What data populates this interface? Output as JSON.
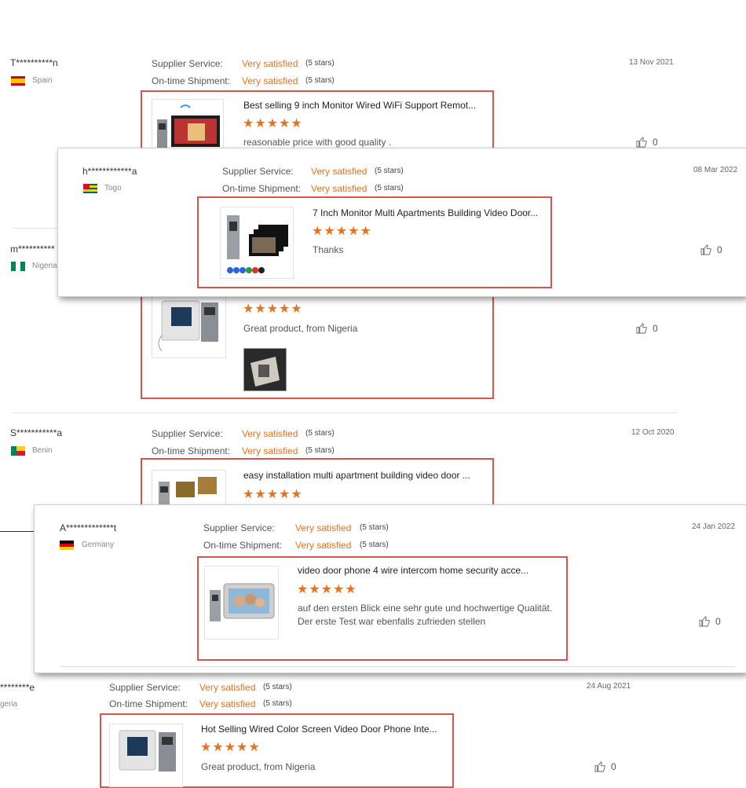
{
  "labels": {
    "supplier": "Supplier Service:",
    "shipment": "On-time Shipment:"
  },
  "colors": {
    "accent": "#e8721e",
    "highlight_box": "#d9534f"
  },
  "icons": {
    "like": "thumbs-up-icon",
    "star": "star-icon"
  },
  "reviews": [
    {
      "user": "T**********n",
      "country": "Spain",
      "flag": "spain-flag",
      "date": "13 Nov 2021",
      "supplier_value": "Very satisfied",
      "supplier_stars": "(5 stars)",
      "supplier_rating": 5,
      "shipment_value": "Very satisfied",
      "shipment_stars": "(5 stars)",
      "shipment_rating": 5,
      "product_title": "Best selling 9 inch Monitor Wired WiFi Support Remot...",
      "stars": "★★★★★",
      "rating": 5,
      "comment": "reasonable price with good quality .",
      "likes": "0"
    },
    {
      "user": "h************a",
      "country": "Togo",
      "flag": "togo-flag",
      "date": "08 Mar 2022",
      "supplier_value": "Very satisfied",
      "supplier_stars": "(5 stars)",
      "supplier_rating": 5,
      "shipment_value": "Very satisfied",
      "shipment_stars": "(5 stars)",
      "shipment_rating": 5,
      "product_title": "7 Inch Monitor Multi Apartments Building Video Door...",
      "stars": "★★★★★",
      "rating": 5,
      "comment": "Thanks",
      "likes": "0"
    },
    {
      "user": "m**********",
      "country": "Nigeria",
      "flag": "nigeria-flag",
      "stars": "★★★★★",
      "rating": 5,
      "comment": "Great product, from Nigeria",
      "likes": "0"
    },
    {
      "user": "S***********a",
      "country": "Benin",
      "flag": "benin-flag",
      "date": "12 Oct 2020",
      "supplier_value": "Very satisfied",
      "supplier_stars": "(5 stars)",
      "supplier_rating": 5,
      "shipment_value": "Very satisfied",
      "shipment_stars": "(5 stars)",
      "shipment_rating": 5,
      "product_title": "easy installation multi apartment building video door ...",
      "stars": "★★★★★",
      "rating": 5
    },
    {
      "user": "A*************t",
      "country": "Germany",
      "flag": "germany-flag",
      "date": "24 Jan 2022",
      "supplier_value": "Very satisfied",
      "supplier_stars": "(5 stars)",
      "supplier_rating": 5,
      "shipment_value": "Very satisfied",
      "shipment_stars": "(5 stars)",
      "shipment_rating": 5,
      "product_title": "video door phone 4 wire intercom home security acce...",
      "stars": "★★★★★",
      "rating": 5,
      "comment_line1": "auf den ersten Blick eine sehr gute und hochwertige Qualität.",
      "comment_line2": "Der erste Test war ebenfalls zufrieden stellen",
      "likes": "0"
    },
    {
      "user": "********e",
      "country": "geria",
      "date": "24 Aug 2021",
      "supplier_value": "Very satisfied",
      "supplier_stars": "(5 stars)",
      "supplier_rating": 5,
      "shipment_value": "Very satisfied",
      "shipment_stars": "(5 stars)",
      "shipment_rating": 5,
      "product_title": "Hot Selling Wired Color Screen Video Door Phone Inte...",
      "stars": "★★★★★",
      "rating": 5,
      "comment": "Great product, from Nigeria",
      "likes": "0"
    }
  ]
}
